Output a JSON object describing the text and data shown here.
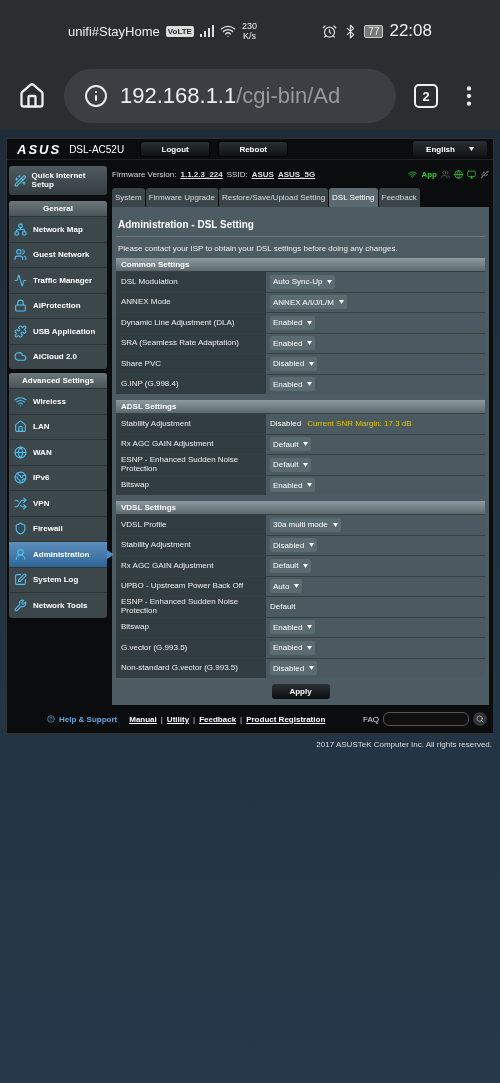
{
  "status_bar": {
    "carrier": "unifi#StayHome",
    "volte": "VoLTE",
    "speed_value": "230",
    "speed_unit": "K/s",
    "battery": "77",
    "time": "22:08"
  },
  "browser": {
    "url_host": "192.168.1.1",
    "url_path": "/cgi-bin/Ad",
    "tab_count": "2"
  },
  "router": {
    "logo": "ASUS",
    "model": "DSL-AC52U",
    "header_buttons": [
      "Logout",
      "Reboot"
    ],
    "language": "English",
    "quick_setup": "Quick Internet Setup",
    "sidebar": [
      {
        "title": "General",
        "items": [
          {
            "label": "Network Map",
            "selected": false
          },
          {
            "label": "Guest Network",
            "selected": false
          },
          {
            "label": "Traffic Manager",
            "selected": false
          },
          {
            "label": "AiProtection",
            "selected": false
          },
          {
            "label": "USB Application",
            "selected": false
          },
          {
            "label": "AiCloud 2.0",
            "selected": false
          }
        ]
      },
      {
        "title": "Advanced Settings",
        "items": [
          {
            "label": "Wireless",
            "selected": false
          },
          {
            "label": "LAN",
            "selected": false
          },
          {
            "label": "WAN",
            "selected": false
          },
          {
            "label": "IPv6",
            "selected": false
          },
          {
            "label": "VPN",
            "selected": false
          },
          {
            "label": "Firewall",
            "selected": false
          },
          {
            "label": "Administration",
            "selected": true
          },
          {
            "label": "System Log",
            "selected": false
          },
          {
            "label": "Network Tools",
            "selected": false
          }
        ]
      }
    ],
    "firmware_label": "Firmware Version:",
    "firmware": "1.1.2.3_224",
    "ssid_label": "SSID:",
    "ssids": [
      "ASUS",
      "ASUS_5G"
    ],
    "app_label": "App",
    "tabs": [
      {
        "label": "System",
        "selected": false
      },
      {
        "label": "Firmware Upgrade",
        "selected": false
      },
      {
        "label": "Restore/Save/Upload Setting",
        "selected": false
      },
      {
        "label": "DSL Setting",
        "selected": true
      },
      {
        "label": "Feedback",
        "selected": false
      }
    ],
    "page_title": "Administration - DSL Setting",
    "notice": "Please contact your ISP to obtain your DSL settings before doing any changes.",
    "sections": [
      {
        "title": "Common Settings",
        "rows": [
          {
            "label": "DSL Modulation",
            "kind": "select",
            "value": "Auto Sync-Up"
          },
          {
            "label": "ANNEX Mode",
            "kind": "select",
            "value": "ANNEX A/I/J/L/M"
          },
          {
            "label": "Dynamic Line Adjustment (DLA)",
            "kind": "select",
            "value": "Enabled"
          },
          {
            "label": "SRA (Seamless Rate Adaptation)",
            "kind": "select",
            "value": "Enabled"
          },
          {
            "label": "Share PVC",
            "kind": "select",
            "value": "Disabled"
          },
          {
            "label": "G.INP (G.998.4)",
            "kind": "select",
            "value": "Enabled"
          }
        ]
      },
      {
        "title": "ADSL Settings",
        "rows": [
          {
            "label": "Stability Adjustment",
            "kind": "status",
            "value": "Disabled",
            "note": "Current SNR Margin: 17.3 dB"
          },
          {
            "label": "Rx AGC GAIN Adjustment",
            "kind": "select",
            "value": "Default"
          },
          {
            "label": "ESNP - Enhanced Sudden Noise Protection",
            "kind": "select",
            "value": "Default"
          },
          {
            "label": "Bitswap",
            "kind": "select",
            "value": "Enabled"
          }
        ]
      },
      {
        "title": "VDSL Settings",
        "rows": [
          {
            "label": "VDSL Profile",
            "kind": "select",
            "value": "30a multi mode"
          },
          {
            "label": "Stability Adjustment",
            "kind": "select",
            "value": "Disabled"
          },
          {
            "label": "Rx AGC GAIN Adjustment",
            "kind": "select",
            "value": "Default"
          },
          {
            "label": "UPBO - Upstream Power Back Off",
            "kind": "select",
            "value": "Auto"
          },
          {
            "label": "ESNP - Enhanced Sudden Noise Protection",
            "kind": "text",
            "value": "Default"
          },
          {
            "label": "Bitswap",
            "kind": "select",
            "value": "Enabled"
          },
          {
            "label": "G.vector (G.993.5)",
            "kind": "select",
            "value": "Enabled"
          },
          {
            "label": "Non-standard G.vector (G.993.5)",
            "kind": "select",
            "value": "Disabled"
          }
        ]
      }
    ],
    "apply": "Apply",
    "footer": {
      "help": "Help & Support",
      "links": [
        "Manual",
        "Utility",
        "Feedback",
        "Product Registration"
      ],
      "separator": "|",
      "faq": "FAQ"
    }
  },
  "copyright": "2017 ASUSTeK Computer Inc. All rights reserved."
}
